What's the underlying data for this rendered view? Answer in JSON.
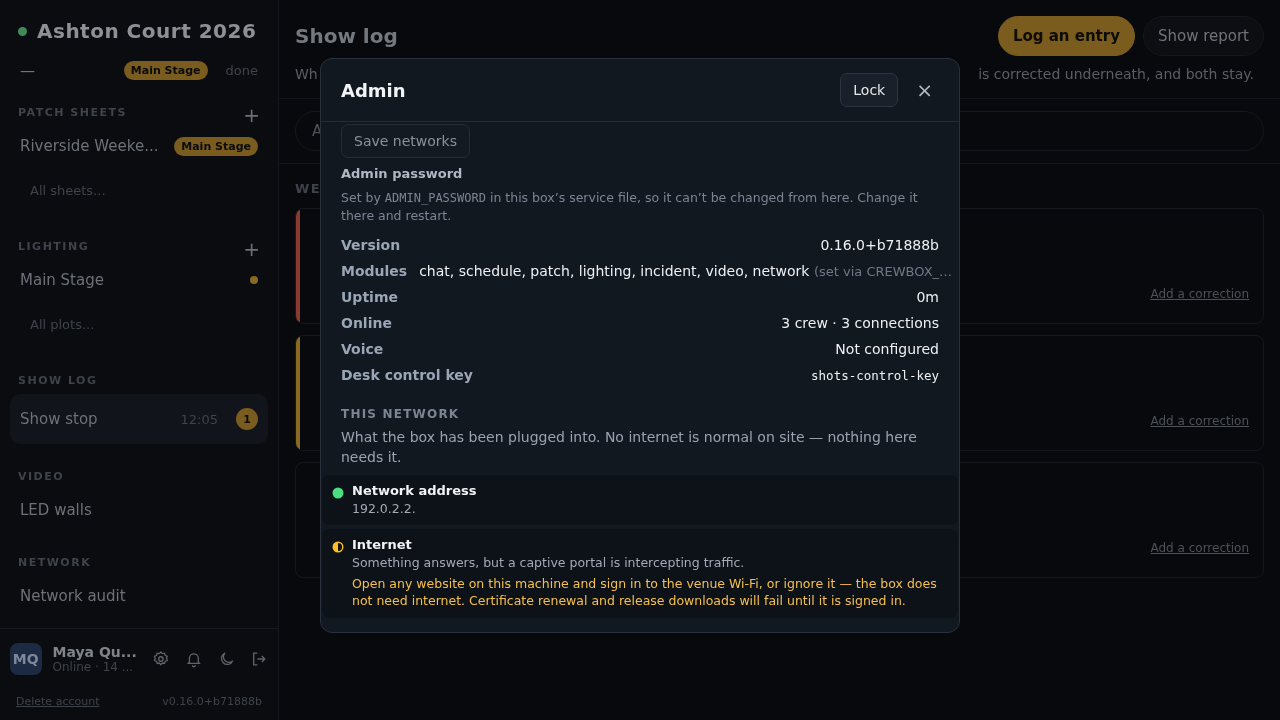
{
  "sidebar": {
    "event": {
      "title": "Ashton Court 2026",
      "color": "#3f8a5a"
    },
    "stage_row": {
      "dash": "—",
      "badge": "Main Stage",
      "status": "done"
    },
    "sections": [
      {
        "title": "PATCH SHEETS",
        "add": "+",
        "items": [
          {
            "label": "Riverside Weeke...",
            "badge": "Main Stage",
            "selected": false
          }
        ],
        "more": "All sheets..."
      },
      {
        "title": "LIGHTING",
        "add": "+",
        "items": [
          {
            "label": "Main Stage",
            "color": "#8a6a22",
            "selected": false
          }
        ],
        "more": "All plots..."
      },
      {
        "title": "SHOW LOG",
        "items": [
          {
            "label": "Show stop",
            "time": "12:05",
            "count": "1",
            "selected": true
          }
        ]
      },
      {
        "title": "VIDEO",
        "items": [
          {
            "label": "LED walls",
            "selected": false
          }
        ]
      },
      {
        "title": "NETWORK",
        "items": [
          {
            "label": "Network audit",
            "selected": false
          }
        ]
      }
    ],
    "user": {
      "initials": "MQ",
      "name": "Maya Qu...",
      "status": "Online · 14 ..."
    },
    "delete_link": "Delete account",
    "version": "v0.16.0+b71888b"
  },
  "main": {
    "title": "Show log",
    "buttons": [
      "Log an entry",
      "Show report"
    ],
    "subtitle_left": "Wh",
    "subtitle_right": "is corrected underneath, and both stay.",
    "search": {
      "placeholder": "A"
    },
    "section": "WE",
    "cards": [
      {
        "link": "Add a correction",
        "color": "#8a3a30"
      },
      {
        "link": "Add a correction",
        "color": "#8a6a22"
      },
      {
        "link": "Add a correction"
      }
    ]
  },
  "dialog": {
    "title": "Admin",
    "lock": "Lock",
    "close": "×",
    "save_button": "Save networks",
    "password_title": "Admin password",
    "password_note": {
      "before": "Set by ",
      "code": "ADMIN_PASSWORD",
      "after": " in this box’s service file, so it can’t be changed from here. Change it there and restart."
    },
    "info": [
      {
        "label": "Version",
        "value": "0.16.0+b71888b"
      },
      {
        "label": "Modules",
        "value": "chat, schedule, patch, lighting, incident, video, network",
        "note": "(set via CREWBOX_…",
        "kind": "inline"
      },
      {
        "label": "Uptime",
        "value": "0m"
      },
      {
        "label": "Online",
        "value": "3 crew · 3 connections"
      },
      {
        "label": "Voice",
        "value": "Not configured"
      },
      {
        "label": "Desk control key",
        "value": "shots-control-key",
        "kind": "code"
      }
    ],
    "network_title": "THIS NETWORK",
    "network_note": "What the box has been plugged into. No internet is normal on site — nothing here needs it.",
    "checks": [
      {
        "title": "Network address",
        "detail": "192.0.2.2.",
        "kind": "full",
        "color": "#4ade80"
      },
      {
        "title": "Internet",
        "detail": "Something answers, but a captive portal is intercepting traffic.",
        "warning": "Open any website on this machine and sign in to the venue Wi-Fi, or ignore it — the box does not need internet. Certificate renewal and release downloads will fail until it is signed in.",
        "kind": "half",
        "color": "#fbbf24"
      }
    ]
  }
}
